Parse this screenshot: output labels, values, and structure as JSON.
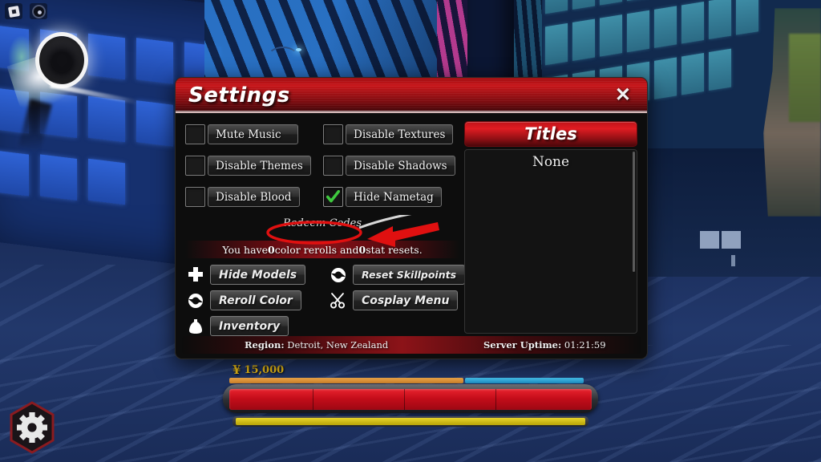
{
  "window": {
    "title": "Settings",
    "close_label": "✕"
  },
  "topleft": {
    "roblox_logo": "roblox-logo-icon",
    "roblox_menu": "roblox-menu-gear-icon"
  },
  "checkboxes": [
    {
      "label": "Mute Music",
      "checked": false,
      "name": "mute-music"
    },
    {
      "label": "Disable Textures",
      "checked": false,
      "name": "disable-textures"
    },
    {
      "label": "Disable Themes",
      "checked": false,
      "name": "disable-themes"
    },
    {
      "label": "Disable Shadows",
      "checked": false,
      "name": "disable-shadows"
    },
    {
      "label": "Disable Blood",
      "checked": false,
      "name": "disable-blood"
    },
    {
      "label": "Hide Nametag",
      "checked": true,
      "name": "hide-nametag"
    }
  ],
  "redeem_codes": {
    "label": "Redeem Codes"
  },
  "stat_banner": {
    "prefix": "You have ",
    "rerolls": "0",
    "middle": " color rerolls and ",
    "resets": "0",
    "suffix": " stat resets."
  },
  "actions": {
    "left": [
      {
        "label": "Hide Models",
        "icon": "cross-icon"
      },
      {
        "label": "Reroll Color",
        "icon": "refresh-icon"
      },
      {
        "label": "Inventory",
        "icon": "bag-icon"
      }
    ],
    "right": [
      {
        "label": "Reset Skillpoints",
        "icon": "refresh-icon"
      },
      {
        "label": "Cosplay Menu",
        "icon": "scissors-icon"
      }
    ]
  },
  "titles": {
    "header": "Titles",
    "items": [
      "None"
    ]
  },
  "footer": {
    "region_label": "Region:",
    "region_value": " Detroit, New Zealand",
    "uptime_label": "Server Uptime:",
    "uptime_value": " 01:21:59"
  },
  "hud": {
    "currency_symbol": "¥",
    "currency_amount": "15,000"
  },
  "colors": {
    "accent_red": "#c7161a",
    "title_red": "#e01c22",
    "check_green": "#3ec93e",
    "gold": "#f5c518",
    "health_red": "#c40d1a",
    "stamina_orange": "#f0a94b",
    "stamina_blue": "#47c3ef",
    "xp_yellow": "#e8d42a",
    "annotation_red": "#e01010"
  }
}
